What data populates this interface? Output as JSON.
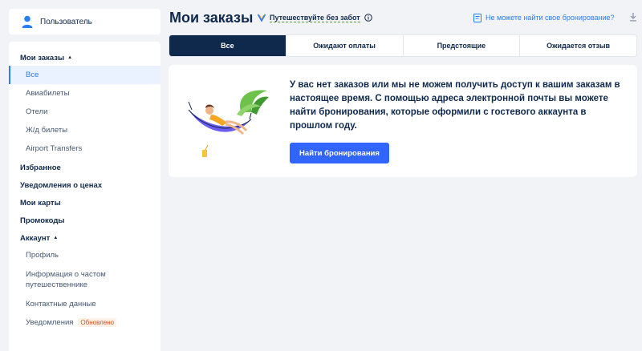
{
  "user": {
    "name": "Пользователь"
  },
  "sidebar": {
    "orders": {
      "title": "Мои заказы",
      "items": [
        "Все",
        "Авиабилеты",
        "Отели",
        "Ж/д билеты",
        "Airport Transfers"
      ]
    },
    "links": [
      "Избранное",
      "Уведомления о ценах",
      "Мои карты",
      "Промокоды"
    ],
    "account": {
      "title": "Аккаунт",
      "items": [
        "Профиль",
        "Информация о частом путешественнике",
        "Контактные данные",
        "Уведомления"
      ],
      "badge": "Обновлено"
    }
  },
  "header": {
    "title": "Мои заказы",
    "promo": "Путешествуйте без забот",
    "help": "Не можете найти свое бронирование?"
  },
  "tabs": [
    "Все",
    "Ожидают оплаты",
    "Предстоящие",
    "Ожидается отзыв"
  ],
  "empty": {
    "message": "У вас нет заказов или мы не можем получить доступ к вашим заказам в настоящее время. С помощью адреса электронной почты вы можете найти бронирования, которые оформили с гостевого аккаунта в прошлом году.",
    "button": "Найти бронирования"
  },
  "colors": {
    "accent": "#287dfa",
    "primary_button": "#3264ff",
    "active_tab": "#0f294d",
    "badge": "#d64f1e"
  }
}
